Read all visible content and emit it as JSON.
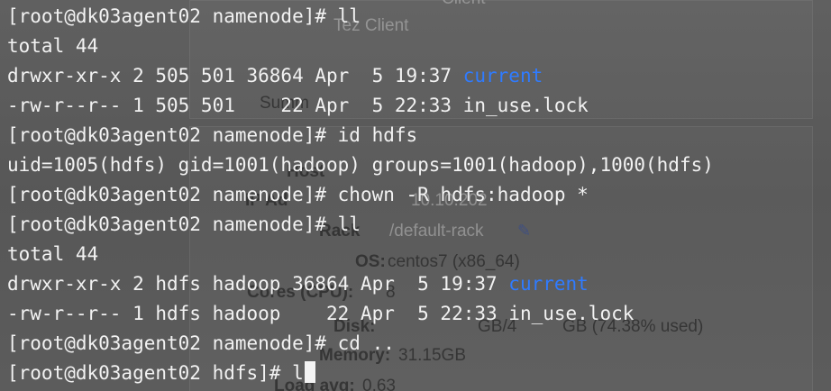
{
  "terminal": {
    "lines": [
      {
        "prompt": "[root@dk03agent02 namenode]# ",
        "cmd": "ll"
      },
      {
        "text": "total 44"
      },
      {
        "text": "drwxr-xr-x 2 505 501 36864 Apr  5 19:37 ",
        "dir": "current"
      },
      {
        "text": "-rw-r--r-- 1 505 501    22 Apr  5 22:33 in_use.lock"
      },
      {
        "prompt": "[root@dk03agent02 namenode]# ",
        "cmd": "id hdfs"
      },
      {
        "text": "uid=1005(hdfs) gid=1001(hadoop) groups=1001(hadoop),1000(hdfs)"
      },
      {
        "prompt": "[root@dk03agent02 namenode]# ",
        "cmd": "chown -R hdfs:hadoop *"
      },
      {
        "prompt": "[root@dk03agent02 namenode]# ",
        "cmd": "ll"
      },
      {
        "text": "total 44"
      },
      {
        "text": "drwxr-xr-x 2 hdfs hadoop 36864 Apr  5 19:37 ",
        "dir": "current"
      },
      {
        "text": "-rw-r--r-- 1 hdfs hadoop    22 Apr  5 22:33 in_use.lock"
      },
      {
        "prompt": "[root@dk03agent02 namenode]# ",
        "cmd": "cd .."
      },
      {
        "prompt": "[root@dk03agent02 hdfs]# ",
        "cmd": "l"
      }
    ]
  },
  "background_page": {
    "client_label": "Client",
    "tez_client": "Tez Client",
    "summary_label": "Summ",
    "host_label": "Host",
    "ip_label": "IP Ad",
    "rack_label": "Rack",
    "rack_value": "/default-rack",
    "os_label": "OS:",
    "os_value": "centos7 (x86_64)",
    "cores_label": "Cores (CPU):",
    "cores_value": "8",
    "disk_label": "Disk:",
    "disk_value": "GB/4",
    "disk_used": "GB (74.38% used)",
    "memory_label": "Memory:",
    "memory_value": "31.15GB",
    "load_label": "Load avg:",
    "load_value": "0.63",
    "ip_value": "10.10.202",
    "edit_icon": "pencil-icon"
  }
}
